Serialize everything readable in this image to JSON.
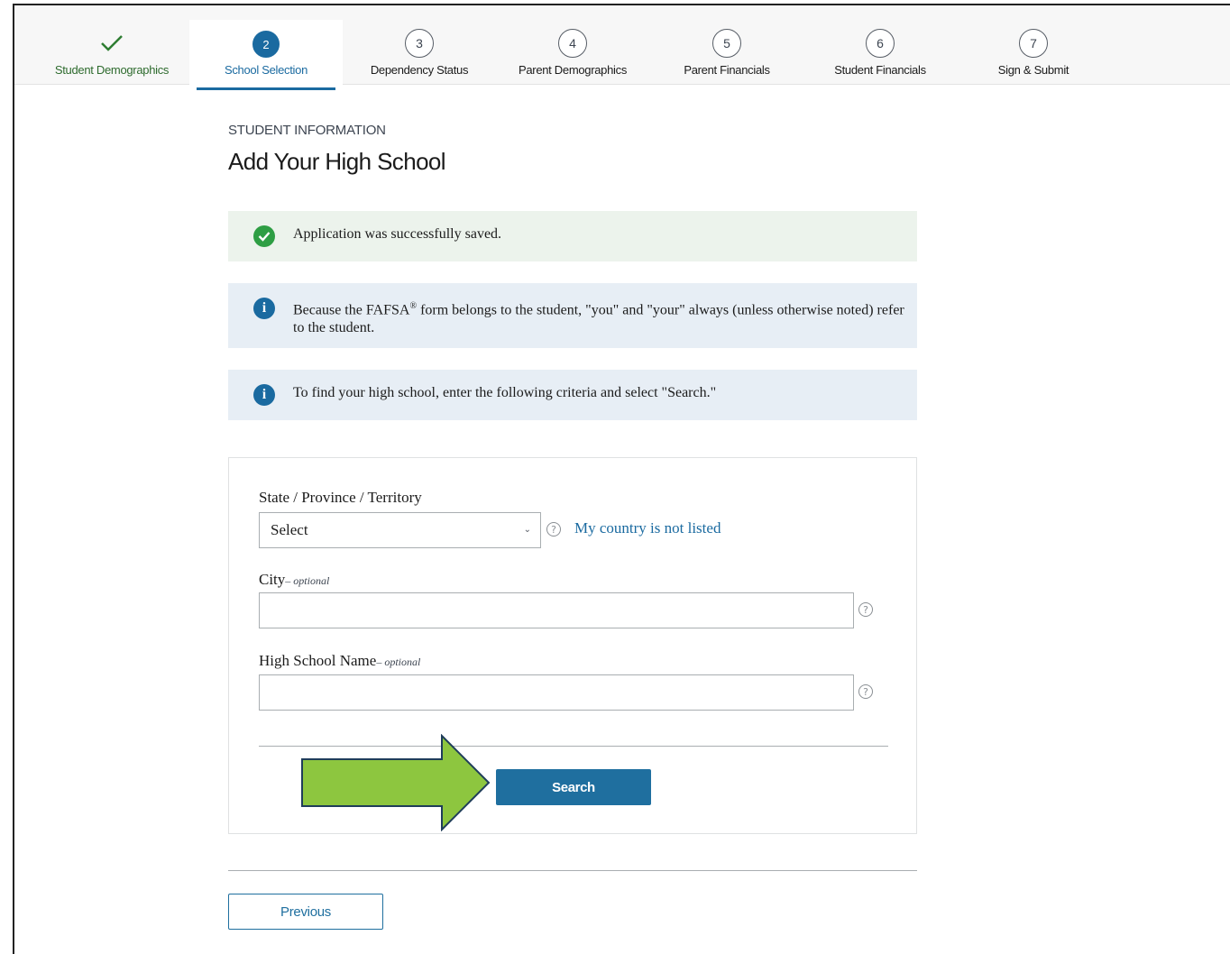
{
  "stepper": {
    "steps": [
      {
        "number": "",
        "label": "Student Demographics",
        "state": "complete",
        "icon": "checkmark-icon"
      },
      {
        "number": "2",
        "label": "School Selection",
        "state": "active"
      },
      {
        "number": "3",
        "label": "Dependency Status",
        "state": "upcoming"
      },
      {
        "number": "4",
        "label": "Parent Demographics",
        "state": "upcoming"
      },
      {
        "number": "5",
        "label": "Parent Financials",
        "state": "upcoming"
      },
      {
        "number": "6",
        "label": "Student Financials",
        "state": "upcoming"
      },
      {
        "number": "7",
        "label": "Sign & Submit",
        "state": "upcoming"
      }
    ]
  },
  "page": {
    "eyebrow": "STUDENT INFORMATION",
    "title": "Add Your High School"
  },
  "alerts": {
    "success": "Application was successfully saved.",
    "info_fafsa_pre": "Because the FAFSA",
    "info_fafsa_sup": "®",
    "info_fafsa_post": " form belongs to the student, \"you\" and \"your\" always (unless otherwise noted) refer to the student.",
    "info_search": "To find your high school, enter the following criteria and select \"Search.\""
  },
  "form": {
    "state_label": "State / Province / Territory",
    "state_value": "Select",
    "help_symbol": "?",
    "country_link": "My country is not listed",
    "city_label": "City",
    "optional_text": "– optional",
    "school_label": "High School Name",
    "search_button": "Search"
  },
  "nav": {
    "previous_button": "Previous"
  },
  "colors": {
    "primary": "#1f6f9f",
    "success": "#2e9e44",
    "annotation_arrow": "#8dc63f"
  }
}
